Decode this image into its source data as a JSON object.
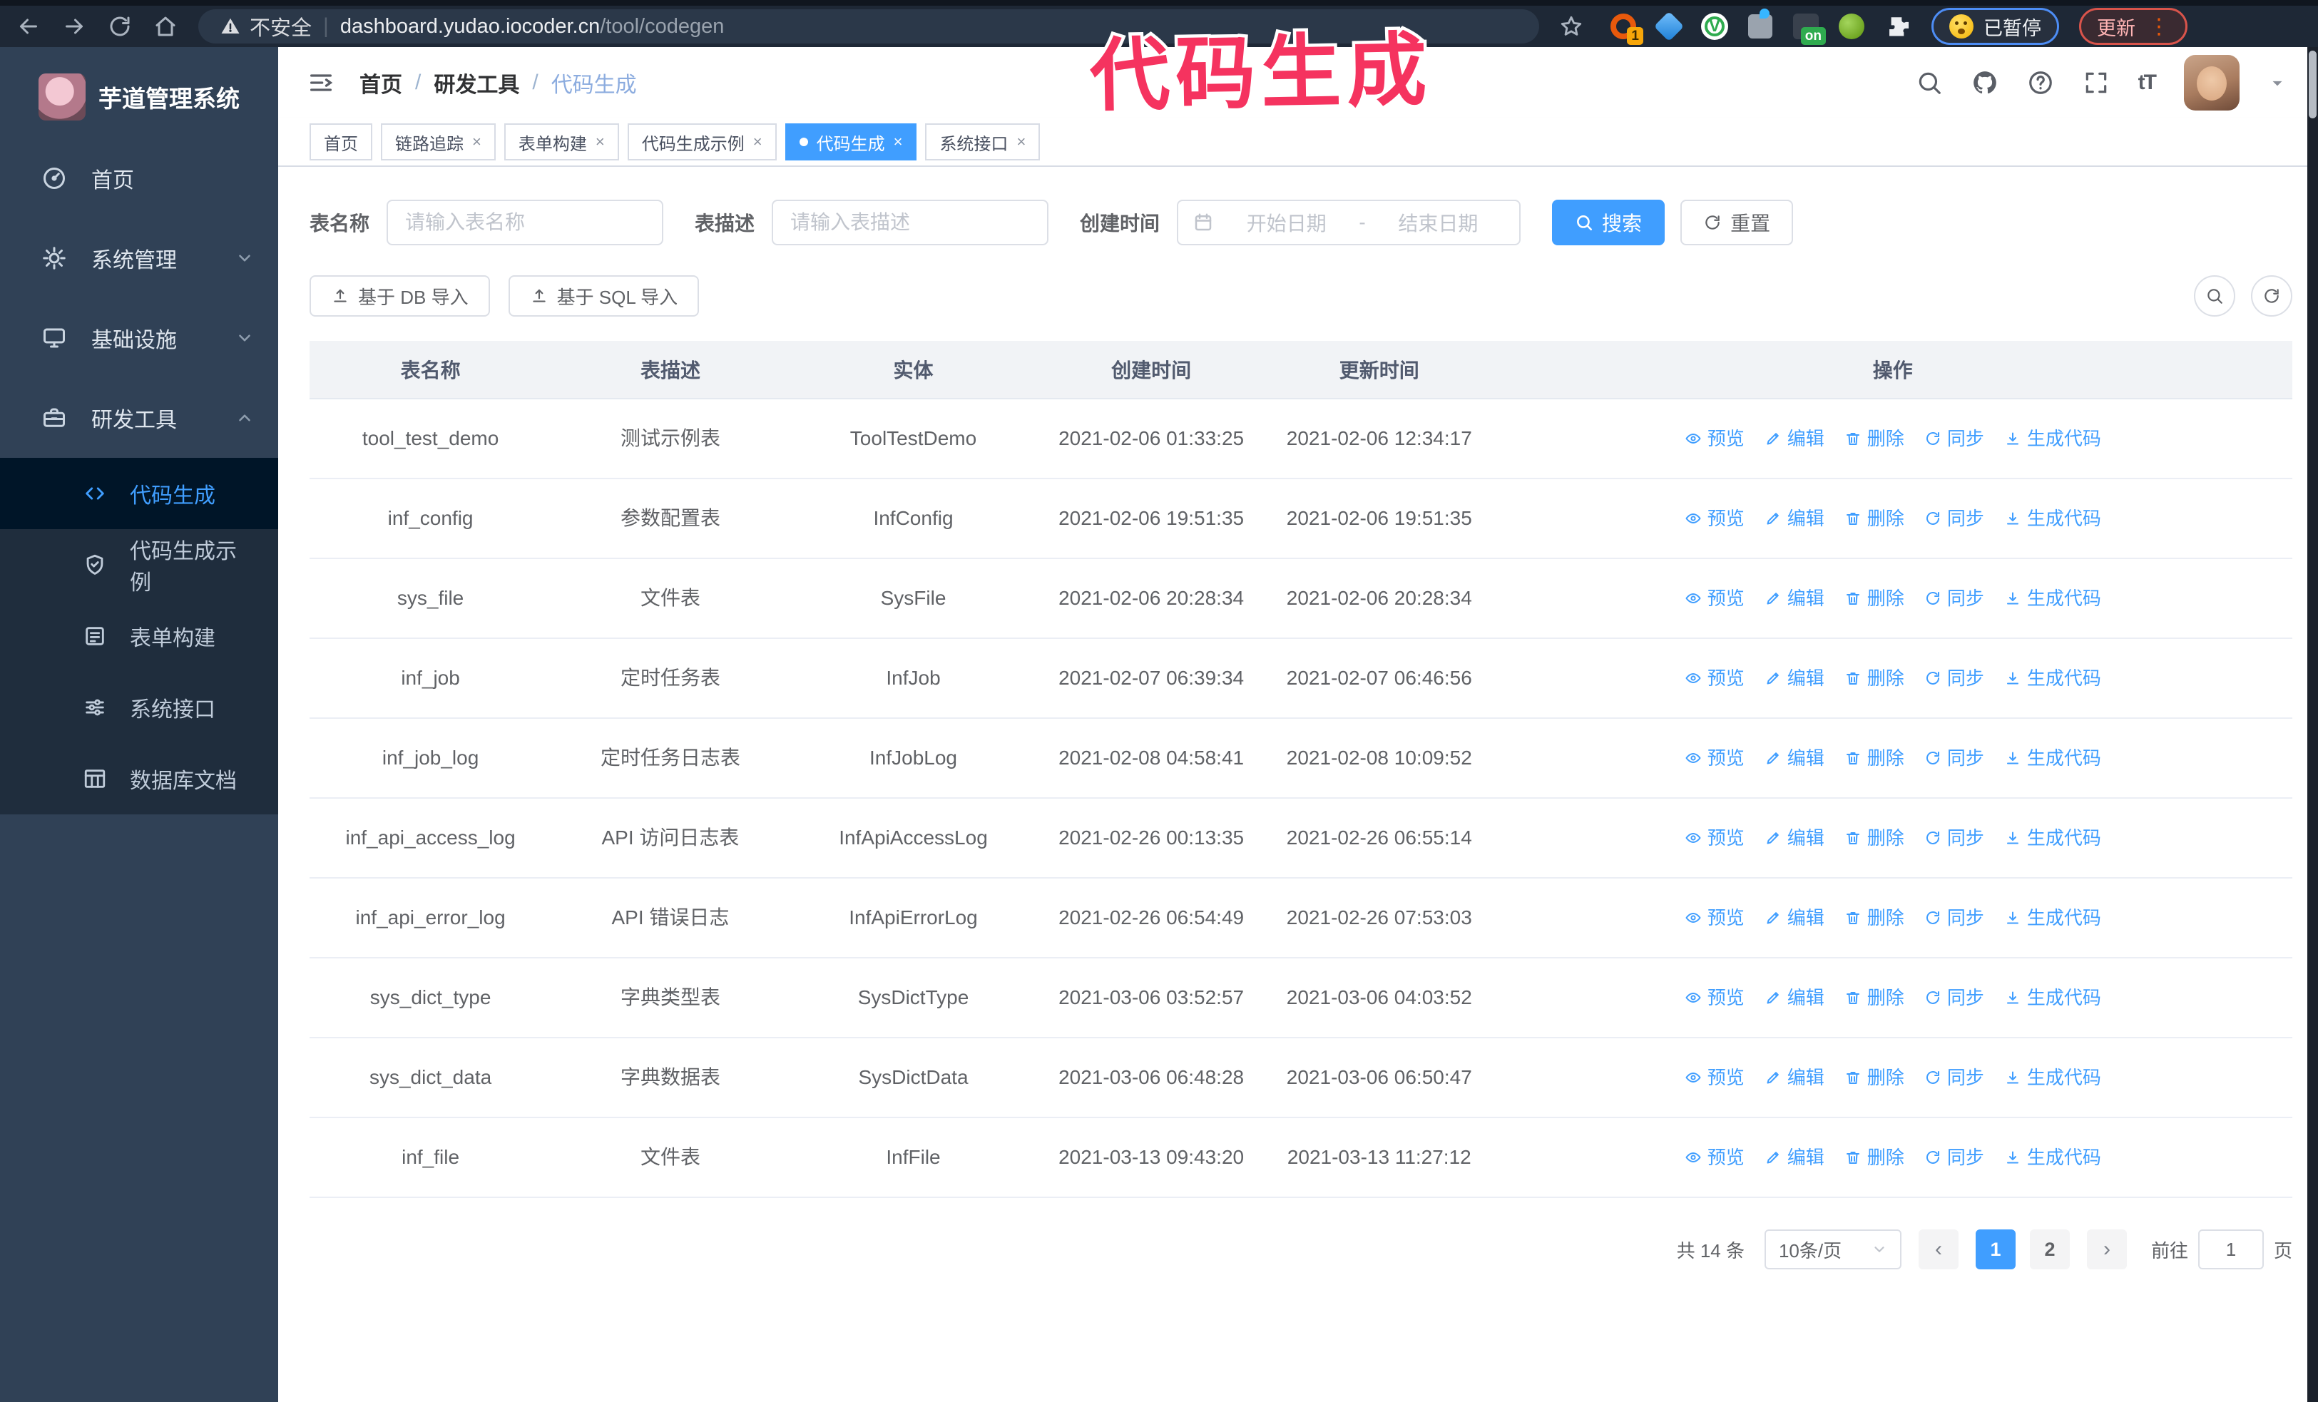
{
  "colors": {
    "accent": "#409eff",
    "annotation_pink": "#f5335f",
    "sidebar_bg": "#304156",
    "submenu_bg": "#1f2d3d",
    "active_item_bg": "#001528"
  },
  "annotation": {
    "text": "代码生成"
  },
  "browser": {
    "security_label": "不安全",
    "url_domain": "dashboard.yudao.iocoder.cn",
    "url_path": "/tool/codegen",
    "extension_badge": "1",
    "extension_on_badge": "on",
    "paused_label": "已暂停",
    "update_label": "更新",
    "kebab": "⋮"
  },
  "sidebar": {
    "title": "芋道管理系统",
    "menu": [
      {
        "label": "首页",
        "icon": "dashboard",
        "expandable": false
      },
      {
        "label": "系统管理",
        "icon": "gear",
        "expandable": true,
        "state": "collapsed"
      },
      {
        "label": "基础设施",
        "icon": "monitor",
        "expandable": true,
        "state": "collapsed"
      },
      {
        "label": "研发工具",
        "icon": "toolbox",
        "expandable": true,
        "state": "expanded",
        "children": [
          {
            "label": "代码生成",
            "icon": "code",
            "active": true
          },
          {
            "label": "代码生成示例",
            "icon": "shield-check",
            "active": false
          },
          {
            "label": "表单构建",
            "icon": "form",
            "active": false
          },
          {
            "label": "系统接口",
            "icon": "sliders",
            "active": false
          },
          {
            "label": "数据库文档",
            "icon": "database",
            "active": false
          }
        ]
      }
    ]
  },
  "navbar": {
    "breadcrumb": [
      "首页",
      "研发工具",
      "代码生成"
    ]
  },
  "tabs": [
    {
      "label": "首页",
      "closable": false,
      "active": false
    },
    {
      "label": "链路追踪",
      "closable": true,
      "active": false
    },
    {
      "label": "表单构建",
      "closable": true,
      "active": false
    },
    {
      "label": "代码生成示例",
      "closable": true,
      "active": false
    },
    {
      "label": "代码生成",
      "closable": true,
      "active": true
    },
    {
      "label": "系统接口",
      "closable": true,
      "active": false
    }
  ],
  "filters": {
    "name_label": "表名称",
    "name_placeholder": "请输入表名称",
    "desc_label": "表描述",
    "desc_placeholder": "请输入表描述",
    "time_label": "创建时间",
    "start_placeholder": "开始日期",
    "range_separator": "-",
    "end_placeholder": "结束日期",
    "search_label": "搜索",
    "reset_label": "重置"
  },
  "toolbar": {
    "import_db_label": "基于 DB 导入",
    "import_sql_label": "基于 SQL 导入"
  },
  "table": {
    "columns": [
      "表名称",
      "表描述",
      "实体",
      "创建时间",
      "更新时间",
      "操作"
    ],
    "actions": [
      "预览",
      "编辑",
      "删除",
      "同步",
      "生成代码"
    ],
    "rows": [
      {
        "name": "tool_test_demo",
        "desc": "测试示例表",
        "entity": "ToolTestDemo",
        "created": "2021-02-06 01:33:25",
        "updated": "2021-02-06 12:34:17"
      },
      {
        "name": "inf_config",
        "desc": "参数配置表",
        "entity": "InfConfig",
        "created": "2021-02-06 19:51:35",
        "updated": "2021-02-06 19:51:35"
      },
      {
        "name": "sys_file",
        "desc": "文件表",
        "entity": "SysFile",
        "created": "2021-02-06 20:28:34",
        "updated": "2021-02-06 20:28:34"
      },
      {
        "name": "inf_job",
        "desc": "定时任务表",
        "entity": "InfJob",
        "created": "2021-02-07 06:39:34",
        "updated": "2021-02-07 06:46:56"
      },
      {
        "name": "inf_job_log",
        "desc": "定时任务日志表",
        "entity": "InfJobLog",
        "created": "2021-02-08 04:58:41",
        "updated": "2021-02-08 10:09:52"
      },
      {
        "name": "inf_api_access_log",
        "desc": "API 访问日志表",
        "entity": "InfApiAccessLog",
        "created": "2021-02-26 00:13:35",
        "updated": "2021-02-26 06:55:14"
      },
      {
        "name": "inf_api_error_log",
        "desc": "API 错误日志",
        "entity": "InfApiErrorLog",
        "created": "2021-02-26 06:54:49",
        "updated": "2021-02-26 07:53:03"
      },
      {
        "name": "sys_dict_type",
        "desc": "字典类型表",
        "entity": "SysDictType",
        "created": "2021-03-06 03:52:57",
        "updated": "2021-03-06 04:03:52"
      },
      {
        "name": "sys_dict_data",
        "desc": "字典数据表",
        "entity": "SysDictData",
        "created": "2021-03-06 06:48:28",
        "updated": "2021-03-06 06:50:47"
      },
      {
        "name": "inf_file",
        "desc": "文件表",
        "entity": "InfFile",
        "created": "2021-03-13 09:43:20",
        "updated": "2021-03-13 11:27:12"
      }
    ]
  },
  "pagination": {
    "total_label": "共 14 条",
    "page_size": "10条/页",
    "pages": [
      "1",
      "2"
    ],
    "active_page": "1",
    "goto_label": "前往",
    "goto_value": "1",
    "page_unit": "页"
  }
}
